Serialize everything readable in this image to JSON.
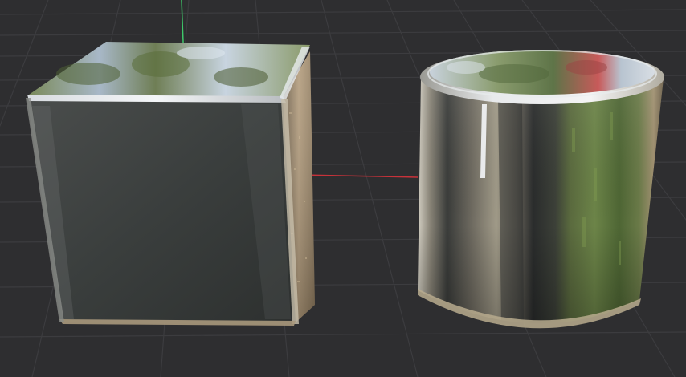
{
  "scene": {
    "background_color": "#2e2e30",
    "grid_color": "#3c3c3f",
    "x_axis_color": "#c8323a",
    "y_axis_color": "#3ec86a",
    "objects": [
      {
        "name": "cube",
        "material": "chrome"
      },
      {
        "name": "cylinder",
        "material": "chrome"
      }
    ]
  }
}
